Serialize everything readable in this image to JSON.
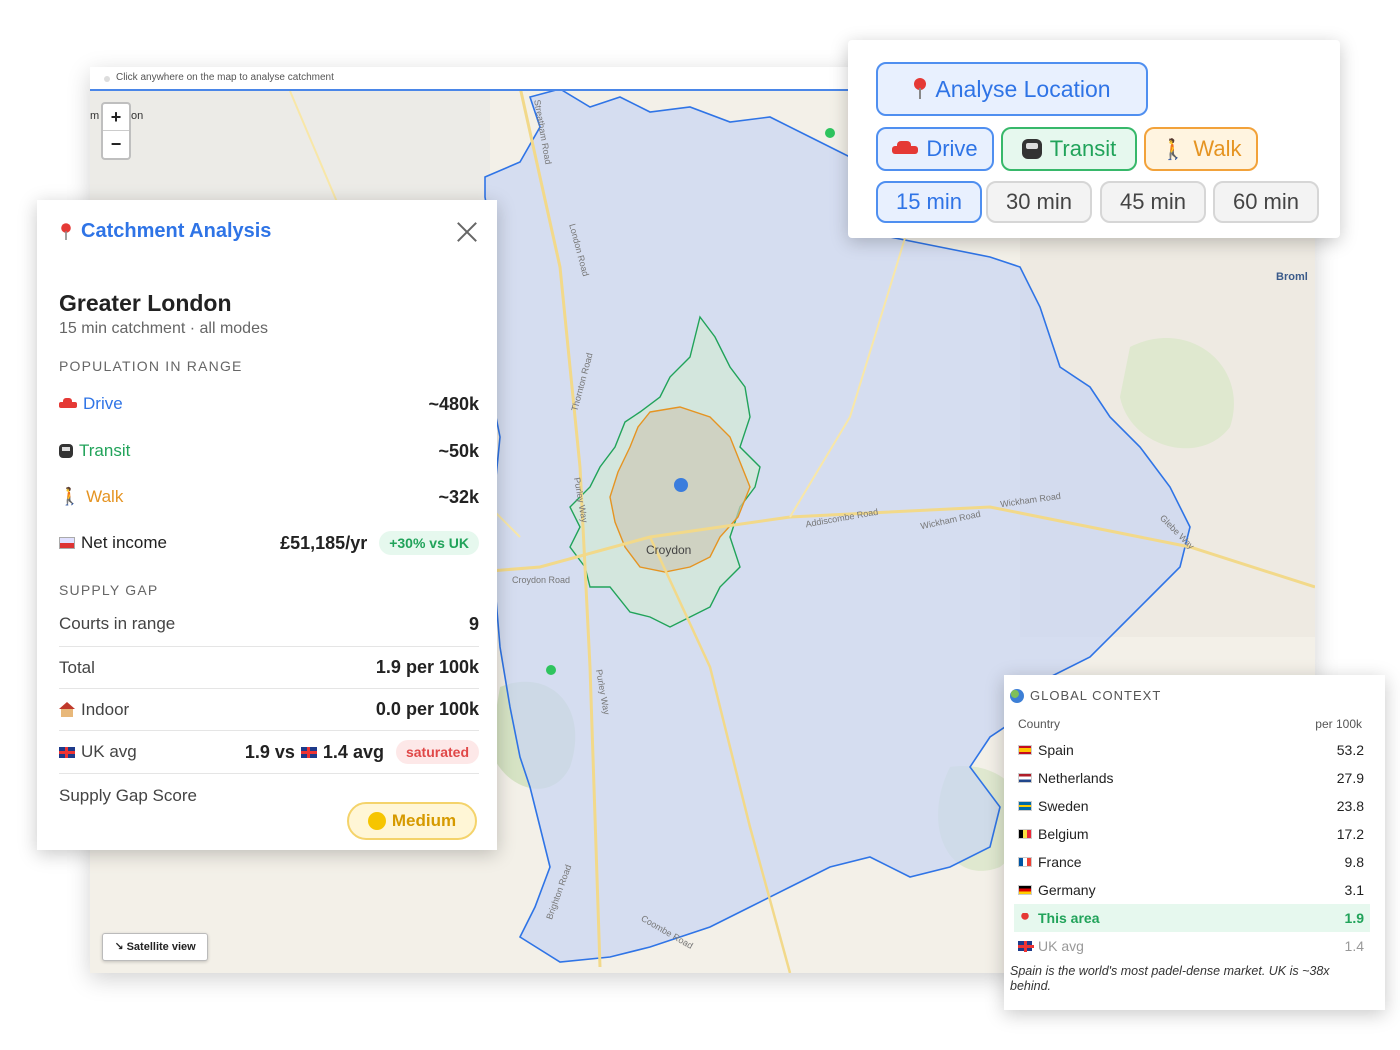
{
  "map": {
    "hint": "Click anywhere on the map to analyse catchment",
    "zoom_in": "+",
    "zoom_out": "−",
    "partial_label_left": "m",
    "partial_label_right": "on",
    "satellite_label": "Satellite view",
    "satellite_icon": "satellite-icon",
    "town_label": "Croydon",
    "edge_label": "Broml",
    "road_labels": [
      "Addiscombe Road",
      "Wickham Road",
      "Wickham Road",
      "Croydon Road",
      "Purley Way",
      "Purley Way",
      "London Road",
      "Thornton Road",
      "Brighton Road",
      "Coombe Road",
      "Glebe Way",
      "Streatham Road"
    ],
    "colors": {
      "drive_fill": "#c9d5f2",
      "drive_stroke": "#2f74e6",
      "transit_stroke": "#21a35a",
      "walk_stroke": "#e59422",
      "center_dot": "#3b7ddd"
    }
  },
  "controls": {
    "analyse_label": "Analyse Location",
    "analyse_icon": "pin-icon",
    "modes": [
      {
        "label": "Drive",
        "icon": "car-icon",
        "active": true
      },
      {
        "label": "Transit",
        "icon": "bus-icon",
        "active": true
      },
      {
        "label": "Walk",
        "icon": "walking-icon",
        "active": true
      }
    ],
    "times": [
      {
        "label": "15 min",
        "active": true
      },
      {
        "label": "30 min",
        "active": false
      },
      {
        "label": "45 min",
        "active": false
      },
      {
        "label": "60 min",
        "active": false
      }
    ]
  },
  "catchment": {
    "title": "Catchment Analysis",
    "place": "Greater London",
    "subtitle": "15 min catchment · all modes",
    "population_heading": "POPULATION IN RANGE",
    "drive_label": "Drive",
    "drive_value": "~480k",
    "transit_label": "Transit",
    "transit_value": "~50k",
    "walk_label": "Walk",
    "walk_value": "~32k",
    "income_label": "Net income",
    "income_value": "£51,185/yr",
    "income_badge": "+30% vs UK",
    "supply_heading": "SUPPLY GAP",
    "courts_label": "Courts in range",
    "courts_value": "9",
    "total_label": "Total",
    "total_value": "1.9 per 100k",
    "indoor_label": "Indoor",
    "indoor_value": "0.0 per 100k",
    "ukavg_label": "UK avg",
    "ukavg_value_a": "1.9 vs",
    "ukavg_value_b": "1.4 avg",
    "ukavg_badge": "saturated",
    "score_label": "Supply Gap Score",
    "score_value": "Medium"
  },
  "global": {
    "title": "GLOBAL CONTEXT",
    "col_country": "Country",
    "col_value": "per 100k",
    "rows": [
      {
        "country": "Spain",
        "value": "53.2",
        "flag": "spain-flag"
      },
      {
        "country": "Netherlands",
        "value": "27.9",
        "flag": "netherlands-flag"
      },
      {
        "country": "Sweden",
        "value": "23.8",
        "flag": "sweden-flag"
      },
      {
        "country": "Belgium",
        "value": "17.2",
        "flag": "belgium-flag"
      },
      {
        "country": "France",
        "value": "9.8",
        "flag": "france-flag"
      },
      {
        "country": "Germany",
        "value": "3.1",
        "flag": "germany-flag"
      },
      {
        "country": "This area",
        "value": "1.9",
        "flag": "pin-icon"
      },
      {
        "country": "UK avg",
        "value": "1.4",
        "flag": "uk-flag"
      }
    ],
    "note": "Spain is the world's most padel-dense market. UK is ~38x behind."
  }
}
